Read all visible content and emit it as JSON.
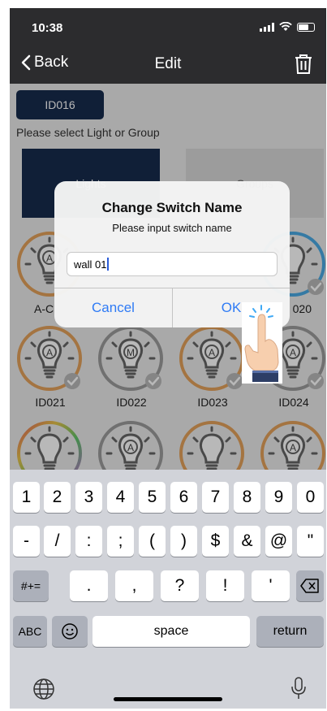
{
  "status_bar": {
    "time": "10:38"
  },
  "nav": {
    "back_label": "Back",
    "title": "Edit"
  },
  "switch_id": "ID016",
  "select_prompt": "Please select Light or Group",
  "tabs": {
    "lights": "Lights",
    "groups": "Groups"
  },
  "devices": [
    {
      "label": "A-C",
      "mode": "A",
      "ring": "#e3a15a",
      "checked": false
    },
    {
      "label": "020",
      "mode": "",
      "ring": "#4aa9e3",
      "checked": true
    },
    {
      "label": "ID021",
      "mode": "A",
      "ring": "#e3a15a",
      "checked": true
    },
    {
      "label": "ID022",
      "mode": "M",
      "ring": "#9b9b9b",
      "checked": true
    },
    {
      "label": "ID023",
      "mode": "A",
      "ring": "#e3a15a",
      "checked": true
    },
    {
      "label": "ID024",
      "mode": "A",
      "ring": "#9b9b9b",
      "checked": true
    },
    {
      "label": "",
      "mode": "",
      "ring": "#c46ad6",
      "checked": false
    },
    {
      "label": "",
      "mode": "A",
      "ring": "#9b9b9b",
      "checked": false
    },
    {
      "label": "",
      "mode": "",
      "ring": "#e3a15a",
      "checked": false
    },
    {
      "label": "",
      "mode": "A",
      "ring": "#e3a15a",
      "checked": false
    }
  ],
  "dialog": {
    "title": "Change Switch Name",
    "message": "Please input switch name",
    "input_value": "wall 01",
    "cancel_label": "Cancel",
    "ok_label": "OK"
  },
  "keyboard": {
    "row1": [
      "1",
      "2",
      "3",
      "4",
      "5",
      "6",
      "7",
      "8",
      "9",
      "0"
    ],
    "row2": [
      "-",
      "/",
      ":",
      ";",
      "(",
      ")",
      "$",
      "&",
      "@",
      "\""
    ],
    "row3_keys": [
      ".",
      ",",
      "?",
      "!",
      "'"
    ],
    "symbols_label": "#+=",
    "abc_label": "ABC",
    "space_label": "space",
    "return_label": "return"
  },
  "colors": {
    "header_bg": "#2c2c2e",
    "navy": "#172b4d",
    "ios_blue": "#2f7bf5"
  }
}
